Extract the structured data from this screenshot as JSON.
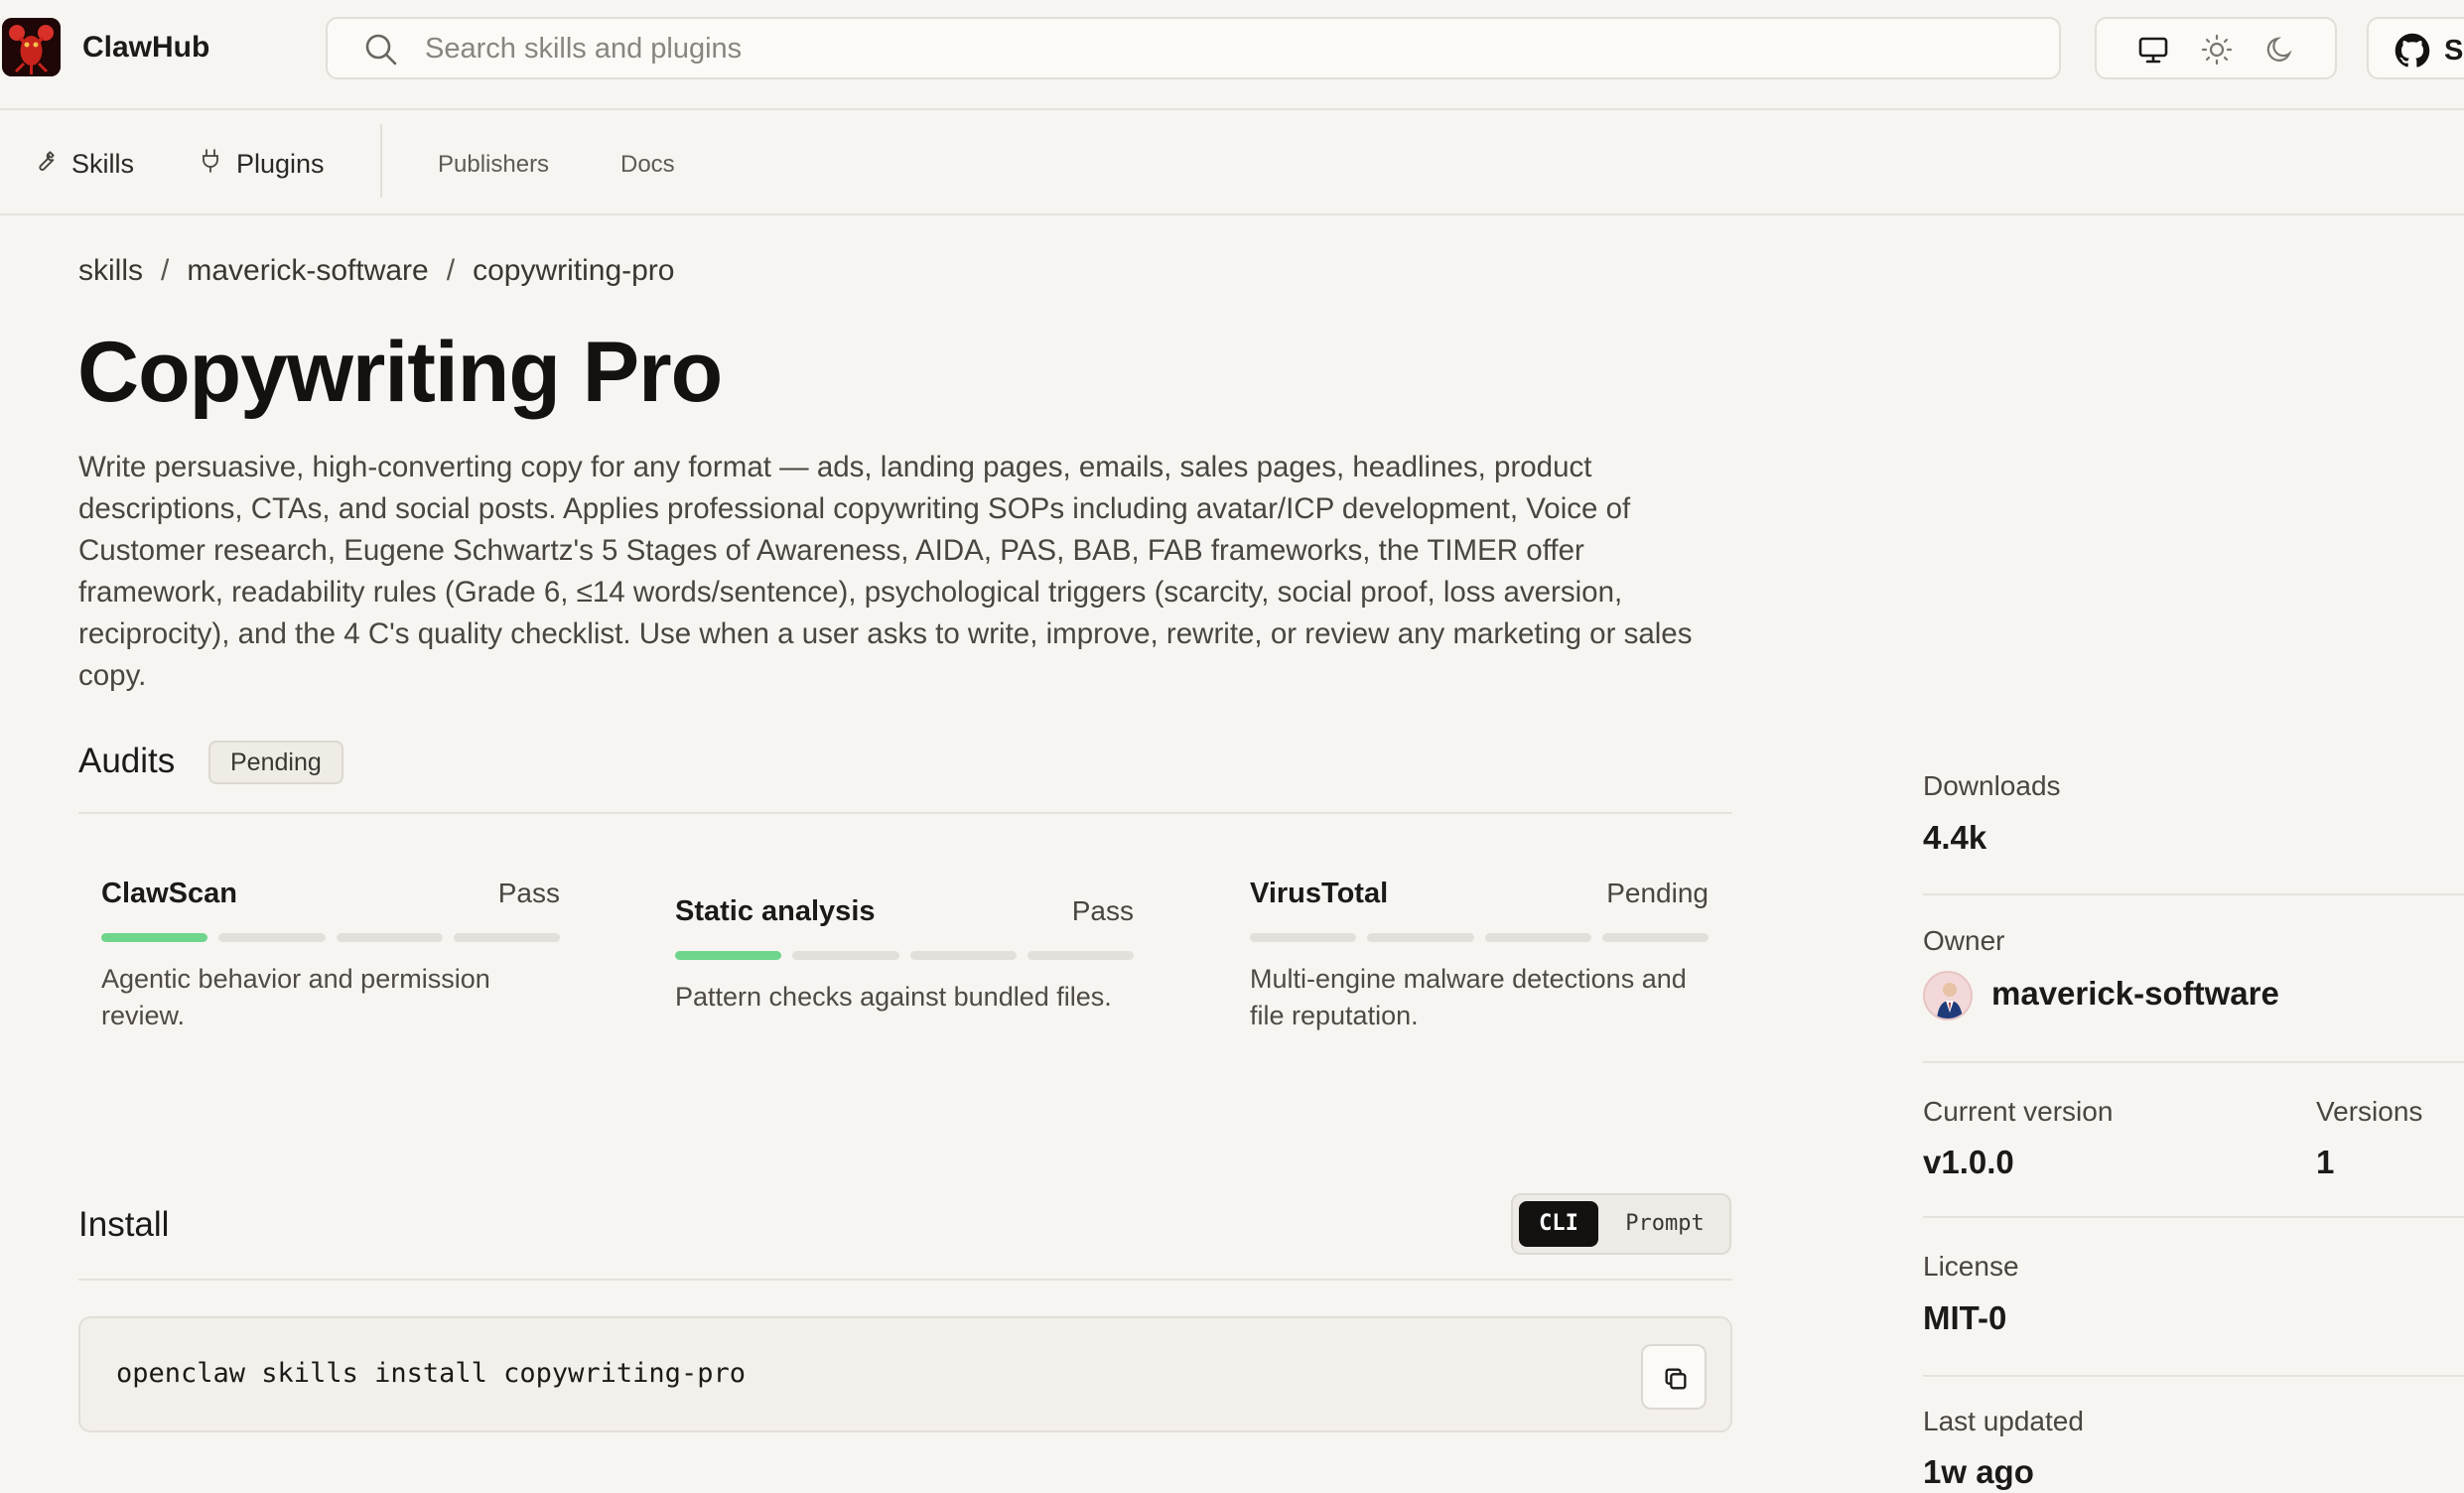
{
  "app": {
    "brand": "ClawHub"
  },
  "search": {
    "placeholder": "Search skills and plugins",
    "value": ""
  },
  "header": {
    "github_label": "S"
  },
  "nav": {
    "skills": "Skills",
    "plugins": "Plugins",
    "publishers": "Publishers",
    "docs": "Docs"
  },
  "breadcrumb": [
    "skills",
    "maverick-software",
    "copywriting-pro"
  ],
  "page": {
    "title": "Copywriting Pro",
    "description": "Write persuasive, high-converting copy for any format — ads, landing pages, emails, sales pages, headlines, product descriptions, CTAs, and social posts. Applies professional copywriting SOPs including avatar/ICP development, Voice of Customer research, Eugene Schwartz's 5 Stages of Awareness, AIDA, PAS, BAB, FAB frameworks, the TIMER offer framework, readability rules (Grade 6, ≤14 words/sentence), psychological triggers (scarcity, social proof, loss aversion, reciprocity), and the 4 C's quality checklist. Use when a user asks to write, improve, rewrite, or review any marketing or sales copy."
  },
  "audits": {
    "title": "Audits",
    "badge": "Pending",
    "items": [
      {
        "name": "ClawScan",
        "status": "Pass",
        "progress_segments_filled": 1,
        "progress_segments_total": 4,
        "description": "Agentic behavior and permission review."
      },
      {
        "name": "Static analysis",
        "status": "Pass",
        "progress_segments_filled": 1,
        "progress_segments_total": 4,
        "description": "Pattern checks against bundled files."
      },
      {
        "name": "VirusTotal",
        "status": "Pending",
        "progress_segments_filled": 0,
        "progress_segments_total": 4,
        "description": "Multi-engine malware detections and file reputation."
      }
    ]
  },
  "install": {
    "title": "Install",
    "tabs": [
      "CLI",
      "Prompt"
    ],
    "active_tab": "CLI",
    "command": "openclaw skills install copywriting-pro"
  },
  "sidebar": {
    "downloads_label": "Downloads",
    "downloads_value": "4.4k",
    "owner_label": "Owner",
    "owner_value": "maverick-software",
    "current_version_label": "Current version",
    "current_version_value": "v1.0.0",
    "versions_label": "Versions",
    "versions_value": "1",
    "license_label": "License",
    "license_value": "MIT-0",
    "last_updated_label": "Last updated",
    "last_updated_value": "1w ago"
  },
  "colors": {
    "background": "#f7f5f1",
    "progress_pass": "#6fd48c",
    "progress_empty": "#e3e0db",
    "active_toggle": "#141210"
  },
  "icons": {
    "logo": "lobster-logo-icon",
    "search": "search-icon",
    "monitor": "monitor-icon",
    "sun": "sun-icon",
    "moon": "moon-icon",
    "github": "github-icon",
    "skills": "wrench-icon",
    "plugins": "plug-icon",
    "copy": "copy-icon"
  }
}
